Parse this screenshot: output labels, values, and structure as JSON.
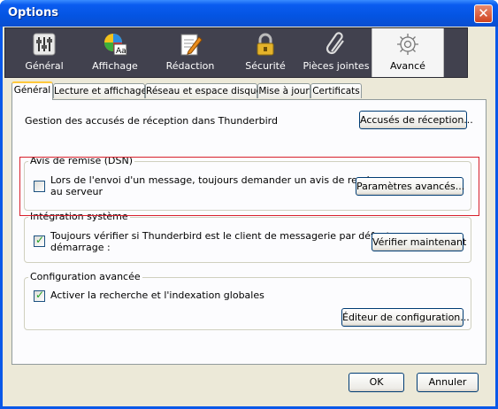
{
  "window": {
    "title": "Options",
    "close_label": "✕"
  },
  "toolbar": {
    "items": [
      {
        "label": "Général",
        "icon": "general-icon"
      },
      {
        "label": "Affichage",
        "icon": "display-icon"
      },
      {
        "label": "Rédaction",
        "icon": "composition-icon"
      },
      {
        "label": "Sécurité",
        "icon": "lock-icon"
      },
      {
        "label": "Pièces jointes",
        "icon": "paperclip-icon"
      },
      {
        "label": "Avancé",
        "icon": "gear-icon",
        "selected": true
      }
    ]
  },
  "tabs": [
    {
      "label": "Général",
      "selected": true
    },
    {
      "label": "Lecture et affichage"
    },
    {
      "label": "Réseau et espace disque"
    },
    {
      "label": "Mise à jour"
    },
    {
      "label": "Certificats"
    }
  ],
  "receipts": {
    "label": "Gestion des accusés de réception dans Thunderbird",
    "button": "Accusés de réception..."
  },
  "dsn": {
    "legend": "Avis de remise (DSN)",
    "checkbox_line1": "Lors de l'envoi d'un message, toujours demander un avis de remise",
    "checkbox_line2": "au serveur",
    "checked": false,
    "button": "Paramètres avancés..."
  },
  "integration": {
    "legend": "Intégration système",
    "checkbox_line1": "Toujours vérifier si Thunderbird est le client de messagerie par défaut au",
    "checkbox_line2": "démarrage :",
    "checked": true,
    "button": "Vérifier maintenant"
  },
  "advanced_config": {
    "legend": "Configuration avancée",
    "checkbox_label": "Activer la recherche et l'indexation globales",
    "checked": true,
    "button": "Éditeur de configuration..."
  },
  "footer": {
    "ok": "OK",
    "cancel": "Annuler"
  },
  "colors": {
    "highlight_border": "#d8202c",
    "titlebar": "#0454e2",
    "toolbar_bg": "#41414e",
    "check_mark": "#21a121"
  }
}
